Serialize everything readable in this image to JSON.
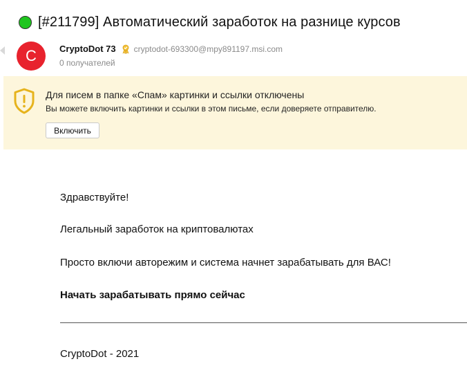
{
  "email": {
    "subject": "[#211799] Автоматический заработок на разнице курсов",
    "status_color": "#1fc51f",
    "sender": {
      "avatar_letter": "C",
      "avatar_color": "#e8222d",
      "name": "CryptoDot 73",
      "badge_icon": "verified-sender-icon",
      "email": "cryptodot-693300@mpy891197.msi.com",
      "recipients": "0 получателей"
    },
    "spam_notice": {
      "icon": "shield-warning-icon",
      "title": "Для писем в папке «Спам» картинки и ссылки отключены",
      "subtitle": "Вы можете включить картинки и ссылки в этом письме, если доверяете отправителю.",
      "button_label": "Включить",
      "background": "#fdf6dc"
    },
    "body": {
      "greeting": "Здравствуйте!",
      "line2": "Легальный заработок на криптовалютах",
      "line3": "Просто включи авторежим и система начнет зарабатывать для ВАС!",
      "cta": "Начать зарабатывать прямо сейчас",
      "footer": "CryptoDot - 2021"
    }
  }
}
